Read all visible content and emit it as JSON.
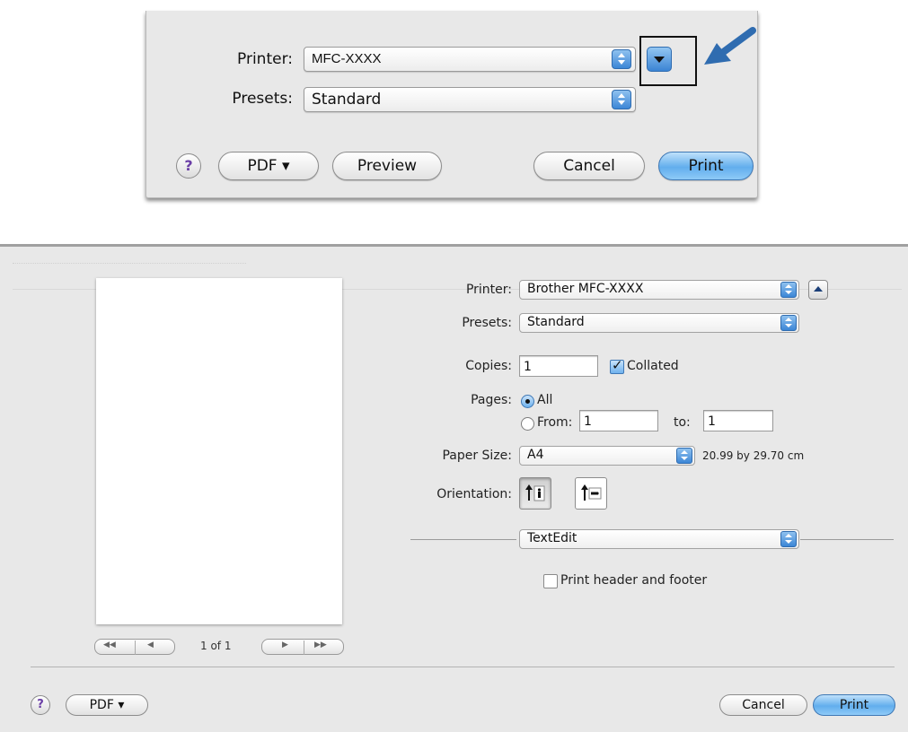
{
  "top_dialog": {
    "printer_label": "Printer:",
    "printer_value": "MFC-XXXX",
    "presets_label": "Presets:",
    "presets_value": "Standard",
    "help": "?",
    "pdf_label": "PDF ▾",
    "preview_label": "Preview",
    "cancel_label": "Cancel",
    "print_label": "Print"
  },
  "bottom_dialog": {
    "page_counter": "1 of 1",
    "printer_label": "Printer:",
    "printer_value": "Brother MFC-XXXX",
    "presets_label": "Presets:",
    "presets_value": "Standard",
    "copies_label": "Copies:",
    "copies_value": "1",
    "collated_label": "Collated",
    "collated_checked": true,
    "pages_label": "Pages:",
    "pages_all_label": "All",
    "pages_from_label": "From:",
    "pages_from_value": "1",
    "pages_to_label": "to:",
    "pages_to_value": "1",
    "paper_size_label": "Paper Size:",
    "paper_size_value": "A4",
    "paper_dimensions": "20.99 by 29.70 cm",
    "orientation_label": "Orientation:",
    "section_menu_value": "TextEdit",
    "header_footer_label": "Print header and footer",
    "header_footer_checked": false,
    "help": "?",
    "pdf_label": "PDF ▾",
    "cancel_label": "Cancel",
    "print_label": "Print"
  },
  "colors": {
    "accent": "#3c86d6",
    "dialog_bg": "#e8e8e8",
    "callout_arrow": "#2f6cb0"
  }
}
